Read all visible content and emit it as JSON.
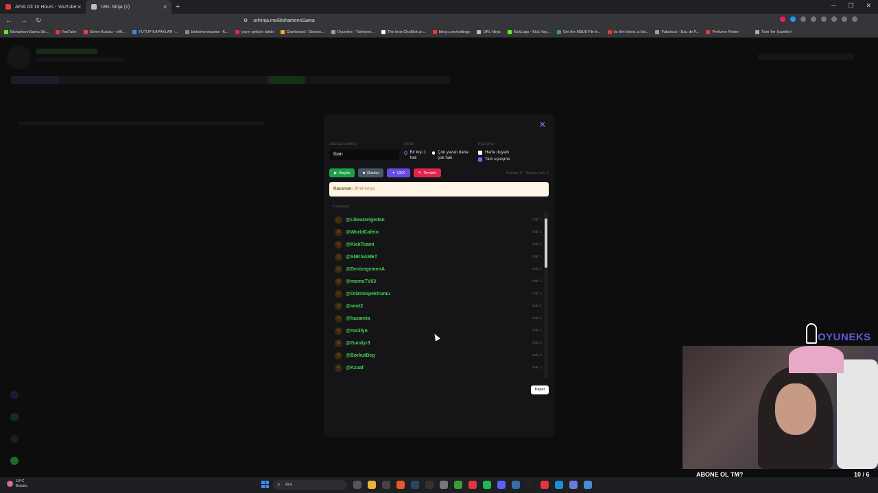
{
  "browser": {
    "tabs": [
      {
        "title": "AFIA Oil 10 Hours - YouTube",
        "color": "#e53935"
      },
      {
        "title": "URL Ninja (1)",
        "color": "#bdbdbd"
      }
    ],
    "url": "urlninja.me/BishamonnSama",
    "bookmarks": [
      {
        "label": "BishamonnSama Str...",
        "color": "#53fc18"
      },
      {
        "label": "YouTube",
        "color": "#e53935"
      },
      {
        "label": "Gelen Kutusu - elift...",
        "color": "#ea4335"
      },
      {
        "label": "YUTUP KAPAKLAR -...",
        "color": "#4285f4"
      },
      {
        "label": "bishamonnsama - K...",
        "color": "#888888"
      },
      {
        "label": "yayın gelişim takibi",
        "color": "#e91e63"
      },
      {
        "label": "Dashboard / Stream...",
        "color": "#f9a825"
      },
      {
        "label": "Oyuneks - Türkiyeni...",
        "color": "#9e9e9e"
      },
      {
        "label": "The best ChatBot an...",
        "color": "#ffffff"
      },
      {
        "label": "blerp.com/settings",
        "color": "#e53935"
      },
      {
        "label": "URL Ninja",
        "color": "#bdbdbd"
      },
      {
        "label": "KickLogs - Kick Yay...",
        "color": "#53fc18"
      },
      {
        "label": "Get the M3U8 File fr...",
        "color": "#43a047"
      },
      {
        "label": "dc film listesi, a list...",
        "color": "#e53935"
      },
      {
        "label": "Fabulous - Eau de P...",
        "color": "#9e9e9e"
      },
      {
        "label": "Perfume Finder",
        "color": "#e53935"
      }
    ],
    "all_bookmarks": "Tüm Yer İşaretleri"
  },
  "modal": {
    "keyword_label": "Anahtar kelime",
    "keyword_value": "Iban",
    "mode_label": "Modu",
    "mode_options": [
      "Bir kişi 1 hak",
      "Çok yazan daha çok hak"
    ],
    "match_label": "Eşleşme",
    "match_options": [
      "Harfe duyarlı",
      "Tam eşleşme"
    ],
    "buttons": {
      "start": "Başlat",
      "stop": "Durdur",
      "draw": "ÇEK",
      "clear": "Temizle"
    },
    "stats": "Katılan: 0 · Toplam hak: 0",
    "winner_label": "Kazanan:",
    "winner_value": "@minenyu",
    "participants_label": "Katılanlar",
    "participants": [
      {
        "initial": "L",
        "name": "@LikeaGelgedan",
        "hak": "hak: 1"
      },
      {
        "initial": "W",
        "name": "@WorldCafein",
        "hak": "hak: 1"
      },
      {
        "initial": "K",
        "name": "@KickTeami",
        "hak": "hak: 1"
      },
      {
        "initial": "S",
        "name": "@SNKSAMET",
        "hak": "hak: 1"
      },
      {
        "initial": "D",
        "name": "@DenizegemenA",
        "hak": "hak: 1"
      },
      {
        "initial": "M",
        "name": "@memoTV03",
        "hak": "hak: 1"
      },
      {
        "initial": "O",
        "name": "@OtizimSpektrumu",
        "hak": "hak: 1"
      },
      {
        "initial": "S",
        "name": "@sent2",
        "hak": "hak: 1"
      },
      {
        "initial": "H",
        "name": "@hasanria",
        "hak": "hak: 1"
      },
      {
        "initial": "R",
        "name": "@ros3lyn",
        "hak": "hak: 1"
      },
      {
        "initial": "G",
        "name": "@Gundyr3",
        "hak": "hak: 1"
      },
      {
        "initial": "B",
        "name": "@BorkutBeg",
        "hak": "hak: 1"
      },
      {
        "initial": "K",
        "name": "@Kzuaf",
        "hak": "hak: 1"
      }
    ],
    "close_button": "Kapat"
  },
  "overlay": {
    "brand": "OYUNEKS",
    "subscribe_text": "ABONE OL TM?",
    "subscribe_count": "10 / 6"
  },
  "taskbar": {
    "temperature": "10°C",
    "weather": "Bulutlu",
    "search_placeholder": "Ara"
  }
}
